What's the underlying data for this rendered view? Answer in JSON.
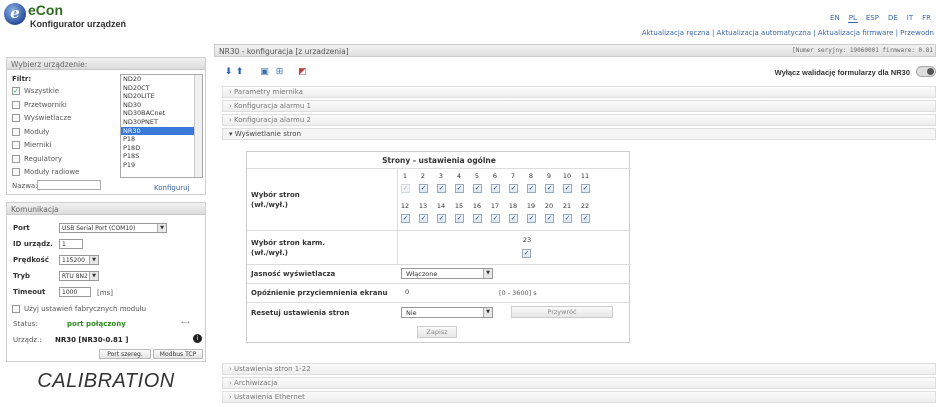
{
  "header": {
    "logo_glyph": "e",
    "logo_text": "eCon",
    "app_title": "Konfigurator urządzeń",
    "languages": [
      "EN",
      "PL",
      "ESP",
      "DE",
      "IT",
      "FR"
    ],
    "active_language": "PL",
    "links": "Aktualizacja ręczna | Aktualizacja automatyczna | Aktualizacja firmware | Przewodn"
  },
  "device_panel": {
    "title": "Wybierz urządzenie:",
    "filter_label": "Filtr:",
    "filters": [
      {
        "label": "Wszystkie",
        "checked": true
      },
      {
        "label": "Przetworniki",
        "checked": false
      },
      {
        "label": "Wyświetlacze",
        "checked": false
      },
      {
        "label": "Moduły",
        "checked": false
      },
      {
        "label": "Mierniki",
        "checked": false
      },
      {
        "label": "Regulatory",
        "checked": false
      },
      {
        "label": "Moduły radiowe",
        "checked": false
      }
    ],
    "devices": [
      "ND20",
      "ND20CT",
      "ND20LITE",
      "ND30",
      "ND30BACnet",
      "ND30PNET",
      "NR30",
      "P18",
      "P18D",
      "P18S",
      "P19"
    ],
    "selected_device": "NR30",
    "name_label": "Nazwa:",
    "name_value": "",
    "configure_link": "Konfiguruj"
  },
  "comm_panel": {
    "title": "Komunikacja",
    "port_label": "Port",
    "port_value": "USB Serial Port (COM10)",
    "id_label": "ID urządz.",
    "id_value": "1",
    "speed_label": "Prędkość",
    "speed_value": "115200",
    "mode_label": "Tryb",
    "mode_value": "RTU 8N2",
    "timeout_label": "Timeout",
    "timeout_value": "1000",
    "timeout_unit": "[ms]",
    "factory_label": "Użyj ustawień fabrycznych modułu",
    "status_label": "Status:",
    "status_value": "port połączony",
    "device_label": "Urządz.:",
    "device_value": "NR30 [NR30-0.81 ]",
    "btn_serial": "Port szereg.",
    "btn_tcp": "Modbus TCP"
  },
  "calibration_text": "CALIBRATION",
  "main": {
    "header_title": "NR30 - konfiguracja [z urzadzenia]",
    "serial_info": "[Numer seryjny: 19060001 firmware: 0.81",
    "validation_label": "Wyłącz walidację formularzy dla NR30",
    "sections_top": [
      "› Parametry miernika",
      "› Konfiguracja alarmu 1",
      "› Konfiguracja alarmu 2"
    ],
    "open_section": "▾ Wyświetlanie stron",
    "sections_bottom": [
      "› Ustawienia stron 1-22",
      "› Archiwizacja",
      "› Ustawienia Ethernet"
    ]
  },
  "pages": {
    "title": "Strony - ustawienia ogólne",
    "select_label": "Wybór stron\n(wł./wył.)",
    "row1_numbers": [
      "1",
      "2",
      "3",
      "4",
      "5",
      "6",
      "7",
      "8",
      "9",
      "10",
      "11"
    ],
    "row2_numbers": [
      "12",
      "13",
      "14",
      "15",
      "16",
      "17",
      "18",
      "19",
      "20",
      "21",
      "22"
    ],
    "karm_label": "Wybór stron karm.\n(wł./wył.)",
    "karm_number": "23",
    "brightness_label": "Jasność wyświetlacza",
    "brightness_value": "Włączone",
    "dim_label": "Opóźnienie przyciemnienia ekranu",
    "dim_value": "0",
    "dim_range": "[0 - 3600] s",
    "reset_label": "Resetuj ustawienia stron",
    "reset_value": "Nie",
    "restore_btn": "Przywróć",
    "save_btn": "Zapisz"
  },
  "icons": [
    "arrow-down-icon",
    "arrow-up-icon",
    "copy-icon",
    "export-icon",
    "import-icon"
  ]
}
